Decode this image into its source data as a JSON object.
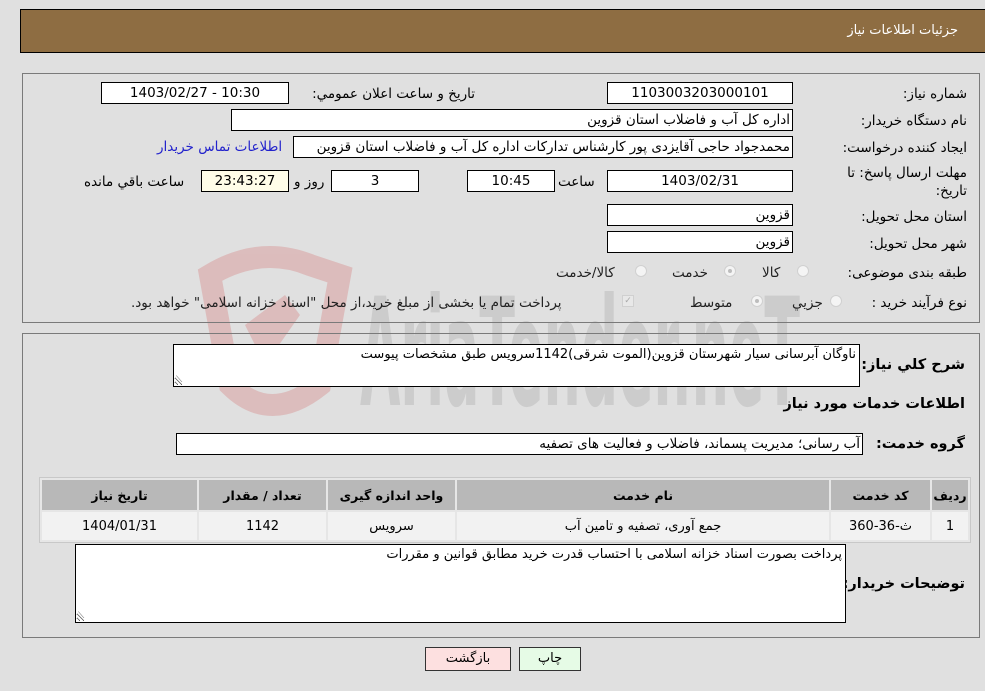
{
  "header": {
    "title": "جزئیات اطلاعات نیاز"
  },
  "form": {
    "need_number": {
      "label": "شماره نیاز:",
      "value": "1103003203000101"
    },
    "announce": {
      "label": "تاريخ و ساعت اعلان عمومي:",
      "value": "1403/02/27 - 10:30"
    },
    "buyer_org": {
      "label": "نام دستگاه خريدار:",
      "value": "اداره کل آب و فاضلاب استان قزوین"
    },
    "requester": {
      "label": "ايجاد کننده درخواست:",
      "value": "محمدجواد حاجی آقایزدی پور کارشناس تدارکات اداره کل آب و فاضلاب استان قزوین"
    },
    "contact_link": "اطلاعات تماس خريدار",
    "deadline": {
      "label": "مهلت ارسال پاسخ: تا تاریخ:",
      "date": "1403/02/31",
      "time_label": "ساعت",
      "time": "10:45",
      "days": "3",
      "days_label": "روز و",
      "remaining": "23:43:27",
      "remaining_label": "ساعت باقي مانده"
    },
    "province": {
      "label": "استان محل تحویل:",
      "value": "قزوین"
    },
    "city": {
      "label": "شهر محل تحویل:",
      "value": "قزوین"
    },
    "category": {
      "label": "طبقه بندی موضوعی:",
      "options": [
        "کالا",
        "خدمت",
        "کالا/خدمت"
      ],
      "selected": "خدمت"
    },
    "purchase_type": {
      "label": "نوع فرآیند خرید :",
      "options": [
        "جزيي",
        "متوسط"
      ],
      "selected": "متوسط",
      "treasury_note": "پرداخت تمام یا بخشی از مبلغ خرید،از محل \"اسناد خزانه اسلامی\" خواهد بود."
    }
  },
  "details": {
    "description_label": "شرح کلي نياز:",
    "description": "ناوگان آبرسانی سیار شهرستان قزوین(الموت شرقی)1142سرویس طبق مشخصات پیوست",
    "services_heading": "اطلاعات خدمات مورد نياز",
    "service_group_label": "گروه خدمت:",
    "service_group": "آب رسانی؛ مدیریت پسماند، فاضلاب و فعالیت های تصفیه",
    "table": {
      "headers": [
        "رديف",
        "کد خدمت",
        "نام خدمت",
        "واحد اندازه گيری",
        "تعداد / مقدار",
        "تاريخ نياز"
      ],
      "rows": [
        [
          "1",
          "ث-36-360",
          "جمع آوری، تصفیه و تامین آب",
          "سرویس",
          "1142",
          "1404/01/31"
        ]
      ]
    },
    "buyer_notes_label": "توضيحات خريدار:",
    "buyer_notes": "پرداخت بصورت اسناد خزانه اسلامی با احتساب قدرت خرید مطابق قوانین و مقررات"
  },
  "buttons": {
    "print": "چاپ",
    "back": "بازگشت"
  },
  "watermark": {
    "text": "AriaTender.neT",
    "color_logo": "#d9a0a0",
    "color_text": "#bdbdbd"
  }
}
